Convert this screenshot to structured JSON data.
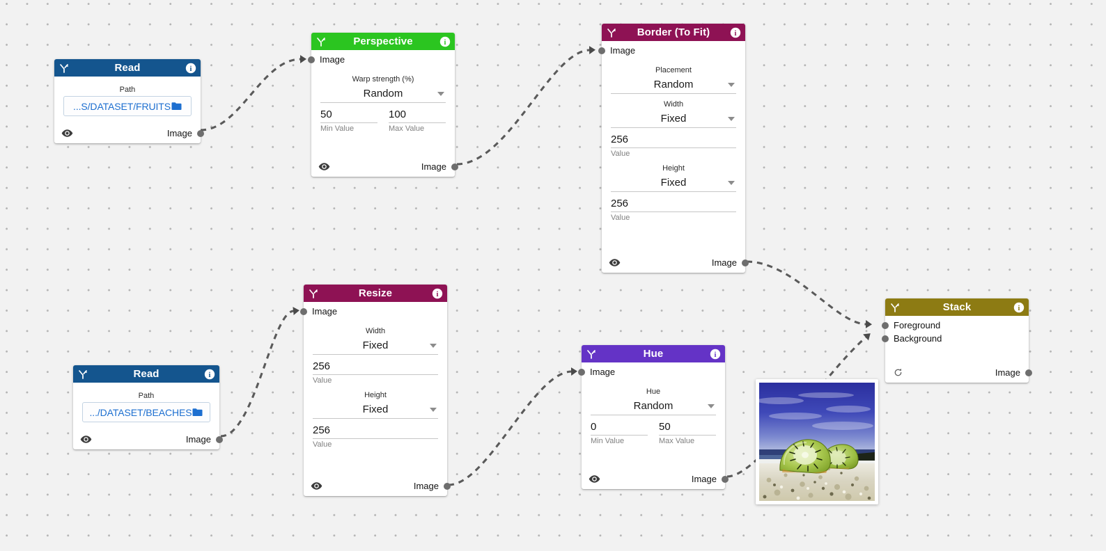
{
  "canvas": {
    "background_color": "#f2f2f2",
    "dot_color": "#b4b4b4"
  },
  "nodes": [
    {
      "id": "read-fruits",
      "title": "Read",
      "header_color": "#14558e",
      "type_icon": "branch-icon",
      "info_icon": "info-icon",
      "inputs": [],
      "path_label": "Path",
      "path_value": "...S/DATASET/FRUITS",
      "folder_icon": "folder-icon",
      "footer_icon": "eye-icon",
      "output_label": "Image"
    },
    {
      "id": "perspective",
      "title": "Perspective",
      "header_color": "#2bc520",
      "type_icon": "branch-icon",
      "info_icon": "info-icon",
      "inputs": [
        "Image"
      ],
      "group_label": "Warp strength (%)",
      "mode_value": "Random",
      "min_value": "50",
      "max_value": "100",
      "min_label": "Min Value",
      "max_label": "Max Value",
      "footer_icon": "eye-icon",
      "output_label": "Image"
    },
    {
      "id": "border-to-fit",
      "title": "Border (To Fit)",
      "header_color": "#8e1254",
      "type_icon": "branch-icon",
      "info_icon": "info-icon",
      "inputs": [
        "Image"
      ],
      "placement_label": "Placement",
      "placement_value": "Random",
      "width_label": "Width",
      "width_mode": "Fixed",
      "width_value": "256",
      "width_value_label": "Value",
      "height_label": "Height",
      "height_mode": "Fixed",
      "height_value": "256",
      "height_value_label": "Value",
      "footer_icon": "eye-icon",
      "output_label": "Image"
    },
    {
      "id": "read-beaches",
      "title": "Read",
      "header_color": "#14558e",
      "type_icon": "branch-icon",
      "info_icon": "info-icon",
      "inputs": [],
      "path_label": "Path",
      "path_value": ".../DATASET/BEACHES",
      "folder_icon": "folder-icon",
      "footer_icon": "eye-icon",
      "output_label": "Image"
    },
    {
      "id": "resize",
      "title": "Resize",
      "header_color": "#8e1254",
      "type_icon": "branch-icon",
      "info_icon": "info-icon",
      "inputs": [
        "Image"
      ],
      "width_label": "Width",
      "width_mode": "Fixed",
      "width_value": "256",
      "width_value_label": "Value",
      "height_label": "Height",
      "height_mode": "Fixed",
      "height_value": "256",
      "height_value_label": "Value",
      "footer_icon": "eye-icon",
      "output_label": "Image"
    },
    {
      "id": "hue",
      "title": "Hue",
      "header_color": "#6433c6",
      "type_icon": "branch-icon",
      "info_icon": "info-icon",
      "inputs": [
        "Image"
      ],
      "group_label": "Hue",
      "mode_value": "Random",
      "min_value": "0",
      "max_value": "50",
      "min_label": "Min Value",
      "max_label": "Max Value",
      "footer_icon": "eye-icon",
      "output_label": "Image"
    },
    {
      "id": "stack",
      "title": "Stack",
      "header_color": "#8d7b13",
      "type_icon": "branch-icon",
      "info_icon": "info-icon",
      "inputs": [
        "Foreground",
        "Background"
      ],
      "footer_icon": "refresh-icon",
      "output_label": "Image"
    }
  ],
  "image_preview": {
    "name": "kiwi-on-beach-preview",
    "alt": "Composited image: two kiwi slices on a pebble beach under a deep blue sky"
  },
  "connections": [
    {
      "from": "read-fruits",
      "to": "perspective"
    },
    {
      "from": "perspective",
      "to": "border-to-fit"
    },
    {
      "from": "border-to-fit",
      "to": "stack-foreground"
    },
    {
      "from": "read-beaches",
      "to": "resize"
    },
    {
      "from": "resize",
      "to": "hue"
    },
    {
      "from": "hue",
      "to": "stack-background"
    }
  ]
}
